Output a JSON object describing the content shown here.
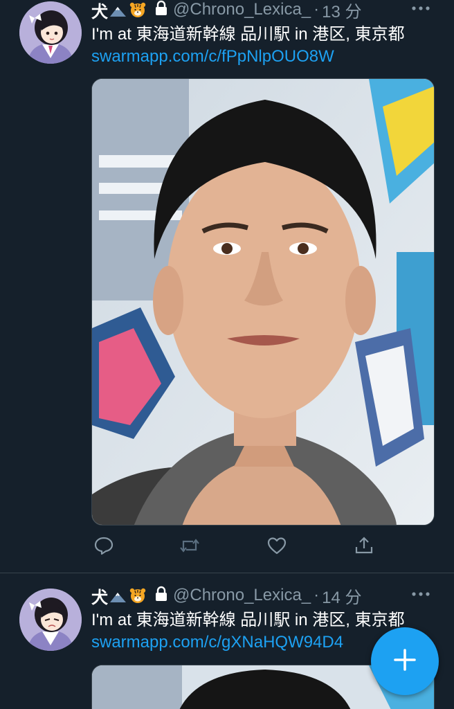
{
  "colors": {
    "background": "#15202b",
    "text": "#ffffff",
    "secondary": "#8899a6",
    "link": "#1da1f2",
    "divider": "#38444d",
    "fab": "#1da1f2"
  },
  "tweets": [
    {
      "display_name": "犬",
      "handle": "@Chrono_Lexica_",
      "separator": "·",
      "time": "13 分",
      "text": "I'm at 東海道新幹線 品川駅 in 港区, 東京都",
      "link": "swarmapp.com/c/fPpNlpOUO8W",
      "icons": [
        "mount-fuji-emoji-icon",
        "tiger-face-emoji-icon",
        "lock-icon",
        "more-dots-icon"
      ],
      "actions": [
        "reply-icon",
        "retweet-icon",
        "like-icon",
        "share-icon"
      ]
    },
    {
      "display_name": "犬",
      "handle": "@Chrono_Lexica_",
      "separator": "·",
      "time": "14 分",
      "text": "I'm at 東海道新幹線 品川駅 in 港区, 東京都",
      "link": "swarmapp.com/c/gXNaHQW94D4",
      "icons": [
        "mount-fuji-emoji-icon",
        "tiger-face-emoji-icon",
        "lock-icon",
        "more-dots-icon"
      ]
    }
  ],
  "compose_button": {
    "icon": "plus-icon"
  }
}
